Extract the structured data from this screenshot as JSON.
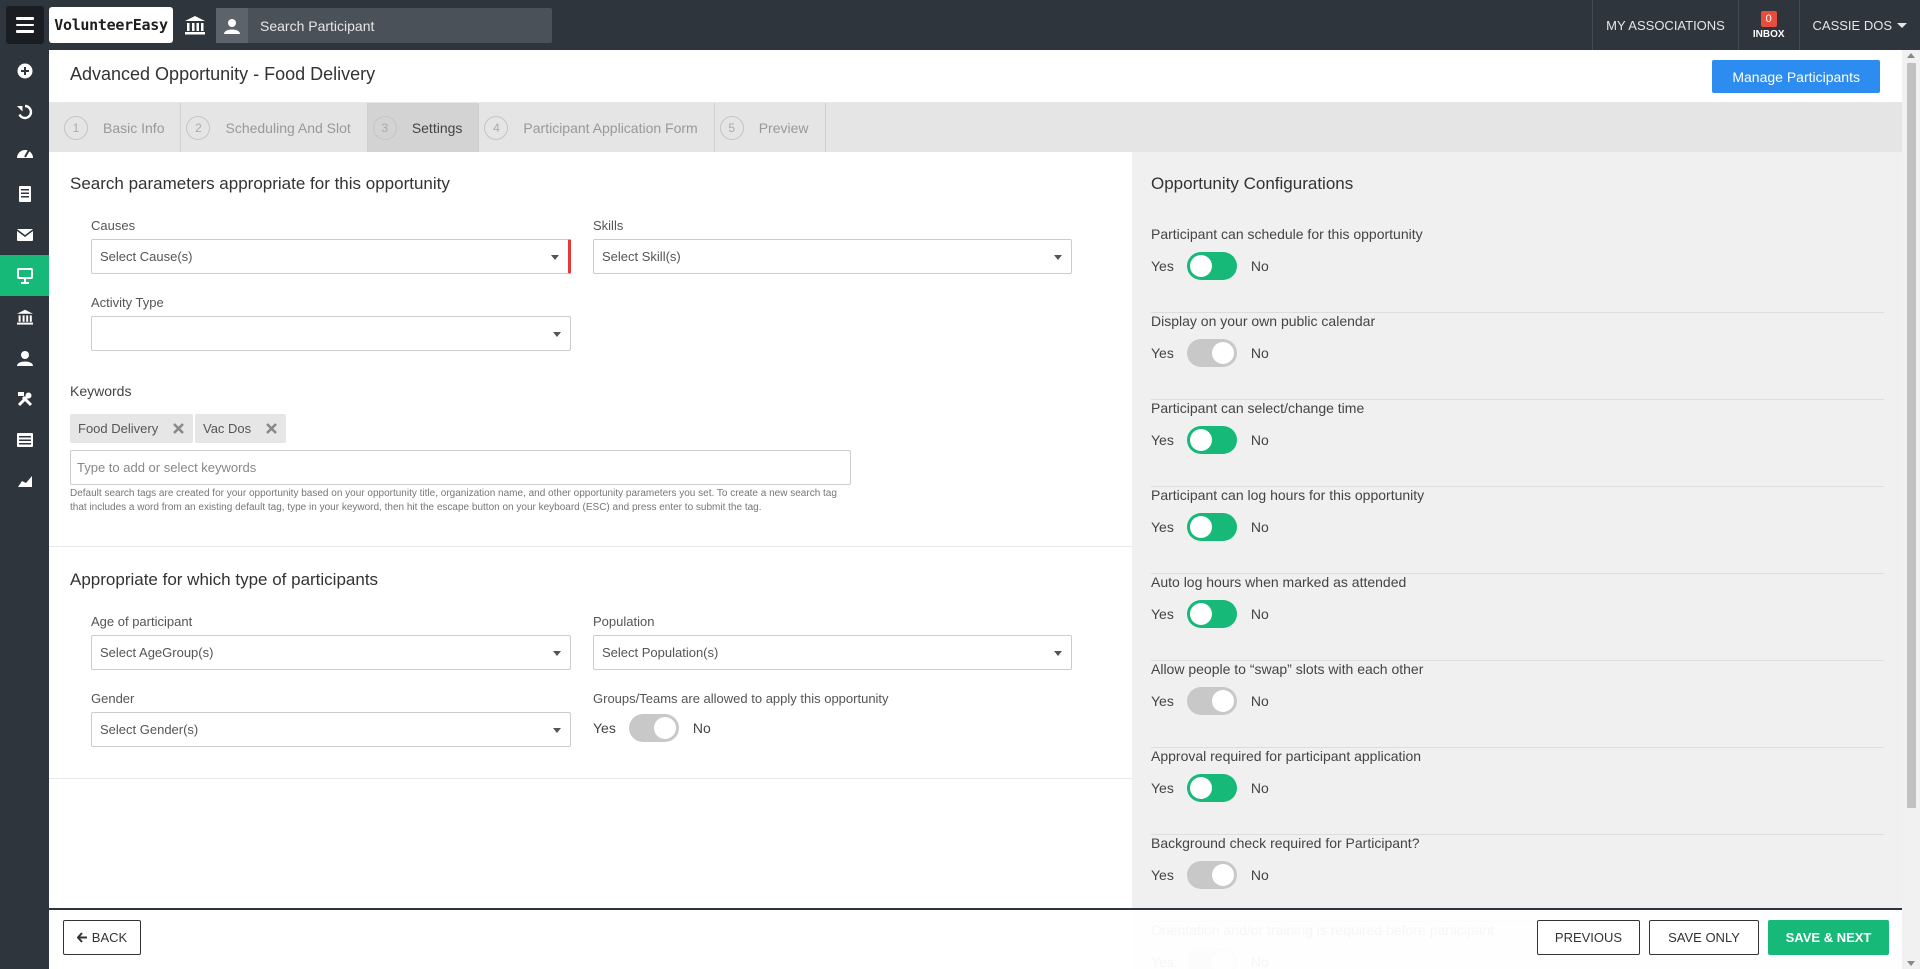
{
  "app": {
    "logo_text": "VolunteerEasy"
  },
  "topbar": {
    "search_placeholder": "Search Participant",
    "my_associations": "MY ASSOCIATIONS",
    "inbox_count": "0",
    "inbox_label": "INBOX",
    "user_name": "CASSIE DOS"
  },
  "sidebar": {
    "items": [
      {
        "icon": "add-icon"
      },
      {
        "icon": "history-icon"
      },
      {
        "icon": "dashboard-icon"
      },
      {
        "icon": "document-icon"
      },
      {
        "icon": "mail-icon"
      },
      {
        "icon": "opportunity-icon",
        "active": true
      },
      {
        "icon": "organization-icon"
      },
      {
        "icon": "person-icon"
      },
      {
        "icon": "tools-icon"
      },
      {
        "icon": "list-icon"
      },
      {
        "icon": "chart-icon"
      }
    ]
  },
  "header": {
    "title": "Advanced Opportunity - Food Delivery",
    "manage_button": "Manage Participants"
  },
  "tabs": [
    {
      "num": "1",
      "label": "Basic Info"
    },
    {
      "num": "2",
      "label": "Scheduling And Slot"
    },
    {
      "num": "3",
      "label": "Settings",
      "active": true
    },
    {
      "num": "4",
      "label": "Participant Application Form"
    },
    {
      "num": "5",
      "label": "Preview"
    }
  ],
  "search_section": {
    "title": "Search parameters appropriate for this opportunity",
    "causes_label": "Causes",
    "causes_placeholder": "Select Cause(s)",
    "skills_label": "Skills",
    "skills_placeholder": "Select Skill(s)",
    "activity_label": "Activity Type",
    "activity_value": "",
    "keywords_label": "Keywords",
    "keywords": [
      "Food Delivery",
      "Vac Dos"
    ],
    "keywords_placeholder": "Type to add or select keywords",
    "keywords_help": "Default search tags are created for your opportunity based on your opportunity title, organization name, and other opportunity parameters you set. To create a new search tag that includes a word from an existing default tag, type in your keyword, then hit the escape button on your keyboard (ESC) and press enter to submit the tag."
  },
  "participant_section": {
    "title": "Appropriate for which type of participants",
    "age_label": "Age of participant",
    "age_placeholder": "Select AgeGroup(s)",
    "population_label": "Population",
    "population_placeholder": "Select Population(s)",
    "gender_label": "Gender",
    "gender_placeholder": "Select Gender(s)",
    "groups_label": "Groups/Teams are allowed to apply this opportunity",
    "groups_value": false
  },
  "toggle_labels": {
    "yes": "Yes",
    "no": "No"
  },
  "config": {
    "title": "Opportunity Configurations",
    "items": [
      {
        "label": "Participant can schedule for this opportunity",
        "on": true
      },
      {
        "label": "Display on your own public calendar",
        "on": false
      },
      {
        "label": "Participant can select/change time",
        "on": true
      },
      {
        "label": "Participant can log hours for this opportunity",
        "on": true
      },
      {
        "label": "Auto log hours when marked as attended",
        "on": true
      },
      {
        "label": "Allow people to “swap” slots with each other",
        "on": false
      },
      {
        "label": "Approval required for participant application",
        "on": true
      },
      {
        "label": "Background check required for Participant?",
        "on": false
      },
      {
        "label": "Orientation and/or training is required before participant",
        "on": false
      }
    ]
  },
  "footer": {
    "back": "BACK",
    "previous": "PREVIOUS",
    "save_only": "SAVE ONLY",
    "save_next": "SAVE & NEXT"
  },
  "colors": {
    "accent_green": "#17b978",
    "primary_blue": "#2d8cf0",
    "dark_bar": "#2f353d",
    "required_red": "#e53935"
  }
}
